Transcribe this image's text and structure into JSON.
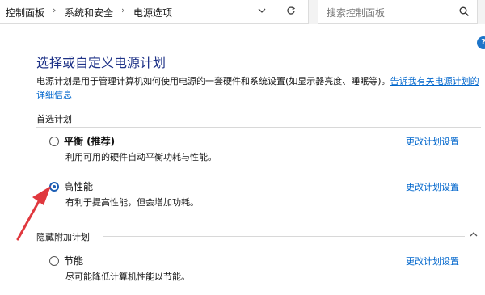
{
  "breadcrumb": {
    "items": [
      "控制面板",
      "系统和安全",
      "电源选项"
    ],
    "separator": "›"
  },
  "search": {
    "placeholder": "搜索控制面板"
  },
  "help": {
    "label": "?"
  },
  "page": {
    "title": "选择或自定义电源计划",
    "description": "电源计划是用于管理计算机如何使用电源的一套硬件和系统设置(如显示器亮度、睡眠等)。",
    "description_link": "告诉我有关电源计划的详细信息"
  },
  "preferred": {
    "label": "首选计划",
    "plans": [
      {
        "name": "平衡 (推荐)",
        "desc": "利用可用的硬件自动平衡功耗与性能。",
        "link": "更改计划设置",
        "selected": false
      },
      {
        "name": "高性能",
        "desc": "有利于提高性能，但会增加功耗。",
        "link": "更改计划设置",
        "selected": true
      }
    ]
  },
  "hidden": {
    "label": "隐藏附加计划",
    "plans": [
      {
        "name": "节能",
        "desc": "尽可能降低计算机性能以节能。",
        "link": "更改计划设置",
        "selected": false
      }
    ]
  },
  "icons": {
    "chevron": "chevron-down-icon",
    "refresh": "refresh-icon",
    "search": "search-icon",
    "collapse": "chevron-up-icon",
    "annotation": "red-arrow"
  },
  "colors": {
    "title": "#1e3287",
    "link": "#0066cc",
    "radio_selected": "#1d5fb5",
    "annotation": "#e0383e"
  }
}
